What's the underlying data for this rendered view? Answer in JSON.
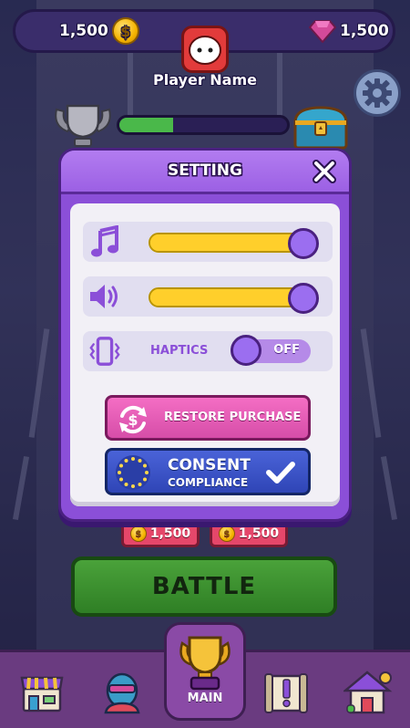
{
  "topbar": {
    "coins": "1,500",
    "gems": "1,500"
  },
  "player": {
    "name": "Player Name"
  },
  "progress": {
    "fraction": 0.32
  },
  "behind": {
    "price_left": "1,500",
    "price_right": "1,500",
    "battle_label": "BATTLE"
  },
  "nav": {
    "items": [
      "shop-icon",
      "character-icon",
      "trophy-icon",
      "quest-icon",
      "house-icon"
    ],
    "main_label": "MAIN"
  },
  "modal": {
    "title": "SETTING",
    "music": {
      "icon": "music-note-icon",
      "level": 1.0
    },
    "sound": {
      "icon": "speaker-icon",
      "level": 1.0
    },
    "haptics": {
      "icon": "vibration-icon",
      "label": "HAPTICS",
      "state": "OFF"
    },
    "restore": {
      "label": "RESTORE PURCHASE",
      "icon": "restore-dollar-icon"
    },
    "consent": {
      "line1": "CONSENT",
      "line2": "COMPLIANCE",
      "icon": "eu-flag-icon"
    }
  },
  "colors": {
    "modal_purple": "#8b4fd8",
    "slider_yellow": "#ffd84a",
    "restore_pink": "#e25cb6",
    "consent_blue": "#3a52c6",
    "battle_green": "#3d9030"
  }
}
